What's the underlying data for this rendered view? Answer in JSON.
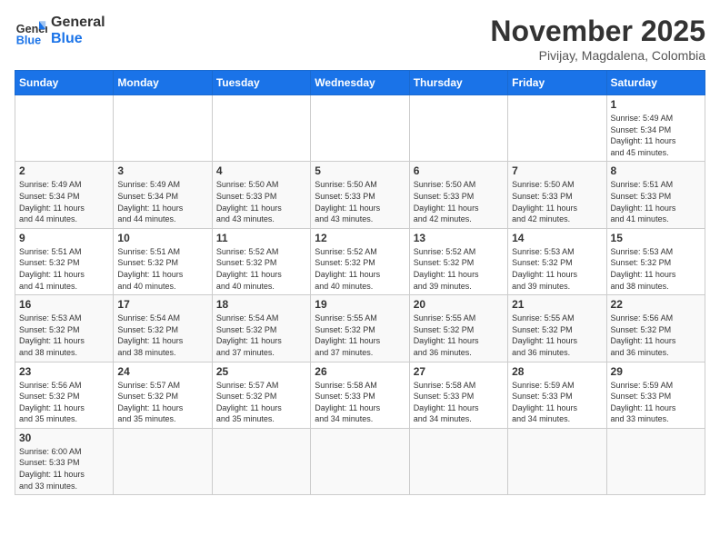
{
  "header": {
    "logo_general": "General",
    "logo_blue": "Blue",
    "month": "November 2025",
    "location": "Pivijay, Magdalena, Colombia"
  },
  "days_of_week": [
    "Sunday",
    "Monday",
    "Tuesday",
    "Wednesday",
    "Thursday",
    "Friday",
    "Saturday"
  ],
  "weeks": [
    {
      "cells": [
        {
          "day": null,
          "info": ""
        },
        {
          "day": null,
          "info": ""
        },
        {
          "day": null,
          "info": ""
        },
        {
          "day": null,
          "info": ""
        },
        {
          "day": null,
          "info": ""
        },
        {
          "day": null,
          "info": ""
        },
        {
          "day": "1",
          "info": "Sunrise: 5:49 AM\nSunset: 5:34 PM\nDaylight: 11 hours\nand 45 minutes."
        }
      ]
    },
    {
      "cells": [
        {
          "day": "2",
          "info": "Sunrise: 5:49 AM\nSunset: 5:34 PM\nDaylight: 11 hours\nand 44 minutes."
        },
        {
          "day": "3",
          "info": "Sunrise: 5:49 AM\nSunset: 5:34 PM\nDaylight: 11 hours\nand 44 minutes."
        },
        {
          "day": "4",
          "info": "Sunrise: 5:50 AM\nSunset: 5:33 PM\nDaylight: 11 hours\nand 43 minutes."
        },
        {
          "day": "5",
          "info": "Sunrise: 5:50 AM\nSunset: 5:33 PM\nDaylight: 11 hours\nand 43 minutes."
        },
        {
          "day": "6",
          "info": "Sunrise: 5:50 AM\nSunset: 5:33 PM\nDaylight: 11 hours\nand 42 minutes."
        },
        {
          "day": "7",
          "info": "Sunrise: 5:50 AM\nSunset: 5:33 PM\nDaylight: 11 hours\nand 42 minutes."
        },
        {
          "day": "8",
          "info": "Sunrise: 5:51 AM\nSunset: 5:33 PM\nDaylight: 11 hours\nand 41 minutes."
        }
      ]
    },
    {
      "cells": [
        {
          "day": "9",
          "info": "Sunrise: 5:51 AM\nSunset: 5:32 PM\nDaylight: 11 hours\nand 41 minutes."
        },
        {
          "day": "10",
          "info": "Sunrise: 5:51 AM\nSunset: 5:32 PM\nDaylight: 11 hours\nand 40 minutes."
        },
        {
          "day": "11",
          "info": "Sunrise: 5:52 AM\nSunset: 5:32 PM\nDaylight: 11 hours\nand 40 minutes."
        },
        {
          "day": "12",
          "info": "Sunrise: 5:52 AM\nSunset: 5:32 PM\nDaylight: 11 hours\nand 40 minutes."
        },
        {
          "day": "13",
          "info": "Sunrise: 5:52 AM\nSunset: 5:32 PM\nDaylight: 11 hours\nand 39 minutes."
        },
        {
          "day": "14",
          "info": "Sunrise: 5:53 AM\nSunset: 5:32 PM\nDaylight: 11 hours\nand 39 minutes."
        },
        {
          "day": "15",
          "info": "Sunrise: 5:53 AM\nSunset: 5:32 PM\nDaylight: 11 hours\nand 38 minutes."
        }
      ]
    },
    {
      "cells": [
        {
          "day": "16",
          "info": "Sunrise: 5:53 AM\nSunset: 5:32 PM\nDaylight: 11 hours\nand 38 minutes."
        },
        {
          "day": "17",
          "info": "Sunrise: 5:54 AM\nSunset: 5:32 PM\nDaylight: 11 hours\nand 38 minutes."
        },
        {
          "day": "18",
          "info": "Sunrise: 5:54 AM\nSunset: 5:32 PM\nDaylight: 11 hours\nand 37 minutes."
        },
        {
          "day": "19",
          "info": "Sunrise: 5:55 AM\nSunset: 5:32 PM\nDaylight: 11 hours\nand 37 minutes."
        },
        {
          "day": "20",
          "info": "Sunrise: 5:55 AM\nSunset: 5:32 PM\nDaylight: 11 hours\nand 36 minutes."
        },
        {
          "day": "21",
          "info": "Sunrise: 5:55 AM\nSunset: 5:32 PM\nDaylight: 11 hours\nand 36 minutes."
        },
        {
          "day": "22",
          "info": "Sunrise: 5:56 AM\nSunset: 5:32 PM\nDaylight: 11 hours\nand 36 minutes."
        }
      ]
    },
    {
      "cells": [
        {
          "day": "23",
          "info": "Sunrise: 5:56 AM\nSunset: 5:32 PM\nDaylight: 11 hours\nand 35 minutes."
        },
        {
          "day": "24",
          "info": "Sunrise: 5:57 AM\nSunset: 5:32 PM\nDaylight: 11 hours\nand 35 minutes."
        },
        {
          "day": "25",
          "info": "Sunrise: 5:57 AM\nSunset: 5:32 PM\nDaylight: 11 hours\nand 35 minutes."
        },
        {
          "day": "26",
          "info": "Sunrise: 5:58 AM\nSunset: 5:33 PM\nDaylight: 11 hours\nand 34 minutes."
        },
        {
          "day": "27",
          "info": "Sunrise: 5:58 AM\nSunset: 5:33 PM\nDaylight: 11 hours\nand 34 minutes."
        },
        {
          "day": "28",
          "info": "Sunrise: 5:59 AM\nSunset: 5:33 PM\nDaylight: 11 hours\nand 34 minutes."
        },
        {
          "day": "29",
          "info": "Sunrise: 5:59 AM\nSunset: 5:33 PM\nDaylight: 11 hours\nand 33 minutes."
        }
      ]
    },
    {
      "cells": [
        {
          "day": "30",
          "info": "Sunrise: 6:00 AM\nSunset: 5:33 PM\nDaylight: 11 hours\nand 33 minutes."
        },
        {
          "day": null,
          "info": ""
        },
        {
          "day": null,
          "info": ""
        },
        {
          "day": null,
          "info": ""
        },
        {
          "day": null,
          "info": ""
        },
        {
          "day": null,
          "info": ""
        },
        {
          "day": null,
          "info": ""
        }
      ]
    }
  ]
}
